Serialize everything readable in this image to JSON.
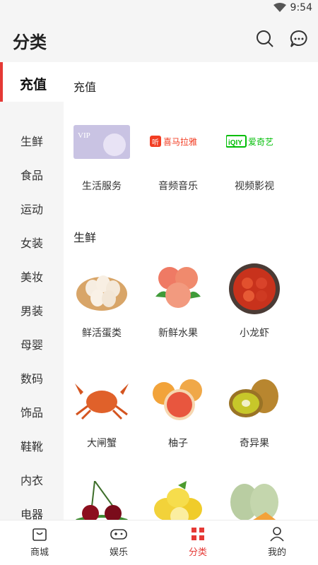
{
  "status": {
    "time": "9:54"
  },
  "header": {
    "title": "分类",
    "search_icon": "search-icon",
    "message_icon": "chat-icon"
  },
  "sidebar": {
    "items": [
      {
        "label": "充值",
        "active": true
      },
      {
        "label": "生鲜"
      },
      {
        "label": "食品"
      },
      {
        "label": "运动"
      },
      {
        "label": "女装"
      },
      {
        "label": "美妆"
      },
      {
        "label": "男装"
      },
      {
        "label": "母婴"
      },
      {
        "label": "数码"
      },
      {
        "label": "饰品"
      },
      {
        "label": "鞋靴"
      },
      {
        "label": "内衣"
      },
      {
        "label": "电器"
      }
    ]
  },
  "sections": [
    {
      "title": "充值",
      "items": [
        {
          "label": "生活服务",
          "image_text": "VIP"
        },
        {
          "label": "音频音乐",
          "image_text": "喜马拉雅"
        },
        {
          "label": "视频影视",
          "image_text": "爱奇艺"
        }
      ]
    },
    {
      "title": "生鲜",
      "items": [
        {
          "label": "鲜活蛋类"
        },
        {
          "label": "新鲜水果"
        },
        {
          "label": "小龙虾"
        },
        {
          "label": "大闸蟹"
        },
        {
          "label": "柚子"
        },
        {
          "label": "奇异果"
        },
        {
          "label": ""
        },
        {
          "label": ""
        },
        {
          "label": ""
        }
      ]
    }
  ],
  "bottom_nav": [
    {
      "label": "商城"
    },
    {
      "label": "娱乐"
    },
    {
      "label": "分类"
    },
    {
      "label": "我的"
    }
  ],
  "colors": {
    "accent": "#e53935",
    "background": "#f5f5f5",
    "panel": "#ffffff"
  }
}
